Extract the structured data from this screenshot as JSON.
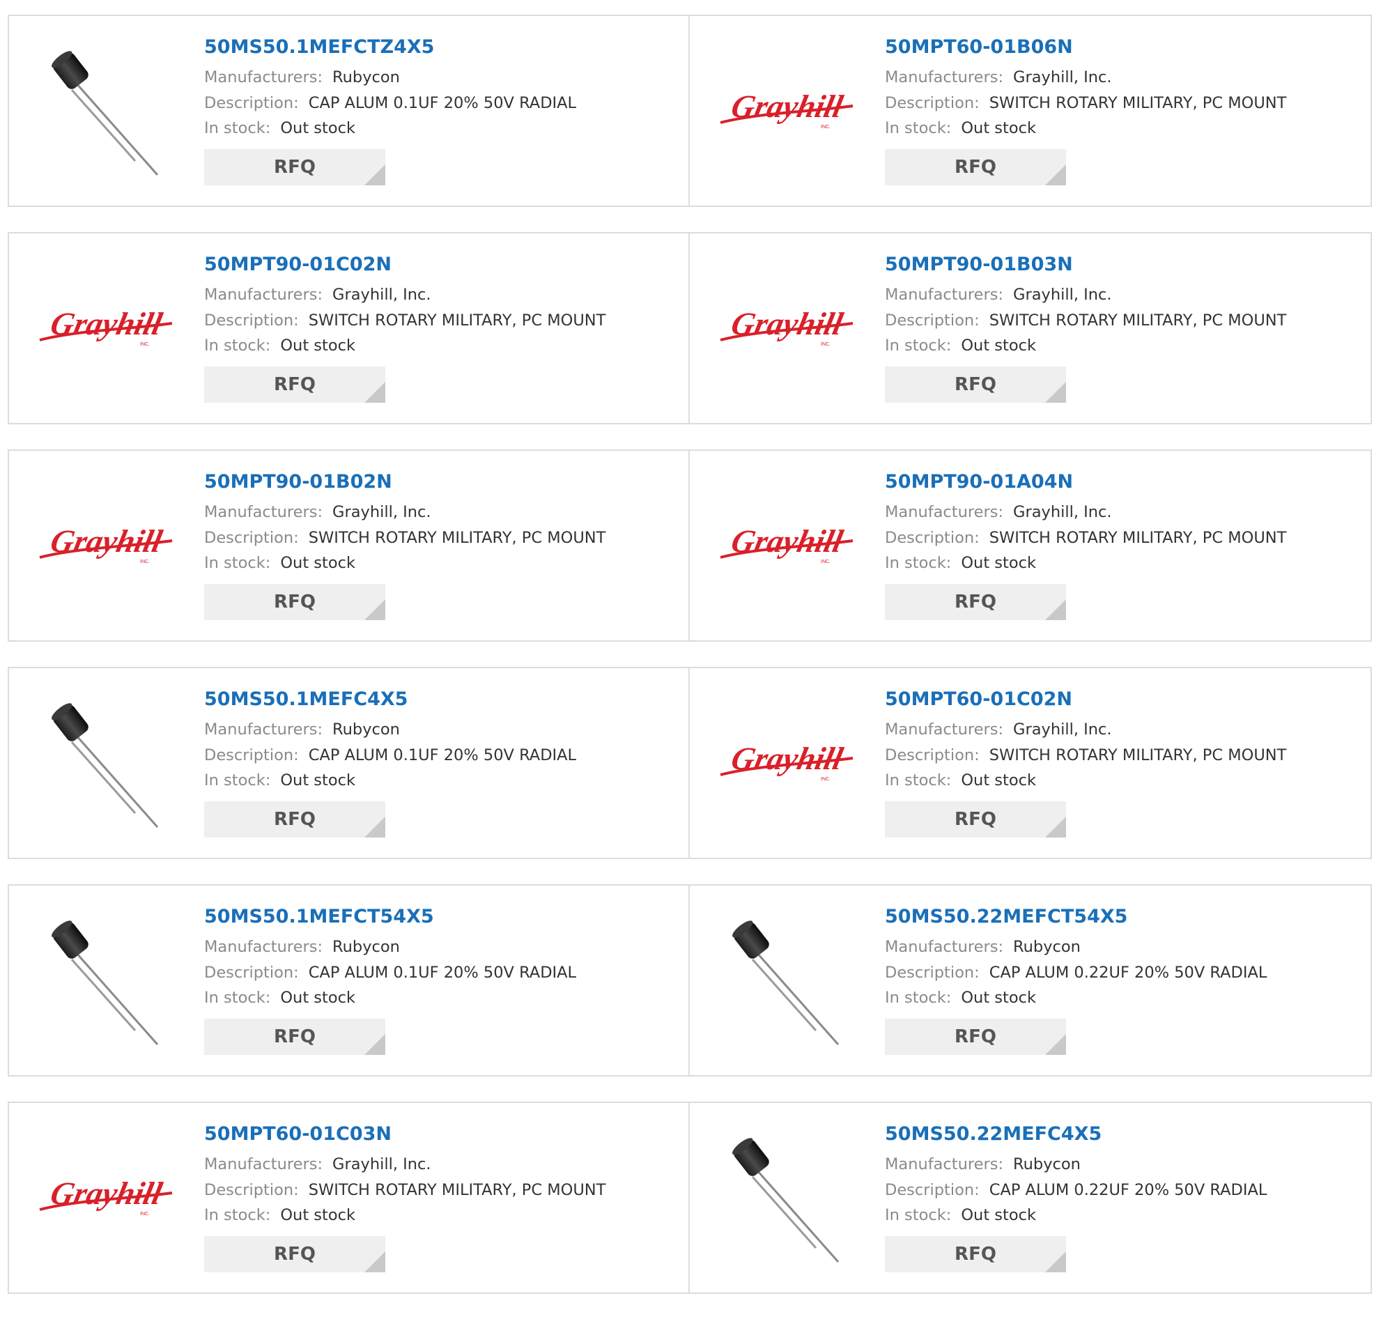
{
  "labels": {
    "manufacturers": "Manufacturers:",
    "description": "Description:",
    "in_stock": "In stock:"
  },
  "rfq_label": "RFQ",
  "brand_colors": {
    "part_link": "#1a6fb8",
    "grayhill_red": "#d9202a",
    "rfq_bg": "#efefef"
  },
  "products": [
    {
      "part": "50MS50.1MEFCTZ4X5",
      "manufacturer": "Rubycon",
      "description": "CAP ALUM 0.1UF 20% 50V RADIAL",
      "stock": "Out stock",
      "image": "capacitor-image",
      "image_text": ""
    },
    {
      "part": "50MPT60-01B06N",
      "manufacturer": "Grayhill, Inc.",
      "description": "SWITCH ROTARY MILITARY, PC MOUNT",
      "stock": "Out stock",
      "image": "grayhill-logo",
      "image_text": "Grayhill"
    },
    {
      "part": "50MPT90-01C02N",
      "manufacturer": "Grayhill, Inc.",
      "description": "SWITCH ROTARY MILITARY, PC MOUNT",
      "stock": "Out stock",
      "image": "grayhill-logo",
      "image_text": "Grayhill"
    },
    {
      "part": "50MPT90-01B03N",
      "manufacturer": "Grayhill, Inc.",
      "description": "SWITCH ROTARY MILITARY, PC MOUNT",
      "stock": "Out stock",
      "image": "grayhill-logo",
      "image_text": "Grayhill"
    },
    {
      "part": "50MPT90-01B02N",
      "manufacturer": "Grayhill, Inc.",
      "description": "SWITCH ROTARY MILITARY, PC MOUNT",
      "stock": "Out stock",
      "image": "grayhill-logo",
      "image_text": "Grayhill"
    },
    {
      "part": "50MPT90-01A04N",
      "manufacturer": "Grayhill, Inc.",
      "description": "SWITCH ROTARY MILITARY, PC MOUNT",
      "stock": "Out stock",
      "image": "grayhill-logo",
      "image_text": "Grayhill"
    },
    {
      "part": "50MS50.1MEFC4X5",
      "manufacturer": "Rubycon",
      "description": "CAP ALUM 0.1UF 20% 50V RADIAL",
      "stock": "Out stock",
      "image": "capacitor-image",
      "image_text": ""
    },
    {
      "part": "50MPT60-01C02N",
      "manufacturer": "Grayhill, Inc.",
      "description": "SWITCH ROTARY MILITARY, PC MOUNT",
      "stock": "Out stock",
      "image": "grayhill-logo",
      "image_text": "Grayhill"
    },
    {
      "part": "50MS50.1MEFCT54X5",
      "manufacturer": "Rubycon",
      "description": "CAP ALUM 0.1UF 20% 50V RADIAL",
      "stock": "Out stock",
      "image": "capacitor-image",
      "image_text": ""
    },
    {
      "part": "50MS50.22MEFCT54X5",
      "manufacturer": "Rubycon",
      "description": "CAP ALUM 0.22UF 20% 50V RADIAL",
      "stock": "Out stock",
      "image": "capacitor-image",
      "image_text": ""
    },
    {
      "part": "50MPT60-01C03N",
      "manufacturer": "Grayhill, Inc.",
      "description": "SWITCH ROTARY MILITARY, PC MOUNT",
      "stock": "Out stock",
      "image": "grayhill-logo",
      "image_text": "Grayhill"
    },
    {
      "part": "50MS50.22MEFC4X5",
      "manufacturer": "Rubycon",
      "description": "CAP ALUM 0.22UF 20% 50V RADIAL",
      "stock": "Out stock",
      "image": "capacitor-image",
      "image_text": ""
    }
  ]
}
